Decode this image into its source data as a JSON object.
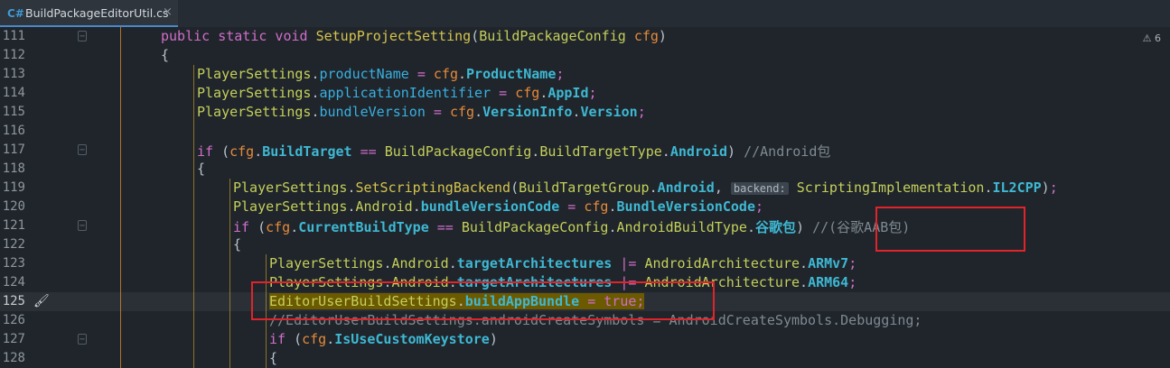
{
  "tab": {
    "lang": "C#",
    "filename": "BuildPackageEditorUtil.cs",
    "close": "×"
  },
  "warnings": {
    "icon": "warning-icon",
    "count": "6"
  },
  "lines": [
    {
      "num": "111",
      "text": "public static void SetupProjectSetting(BuildPackageConfig cfg)"
    },
    {
      "num": "112",
      "text": "{"
    },
    {
      "num": "113",
      "text": "PlayerSettings.productName = cfg.ProductName;"
    },
    {
      "num": "114",
      "text": "PlayerSettings.applicationIdentifier = cfg.AppId;"
    },
    {
      "num": "115",
      "text": "PlayerSettings.bundleVersion = cfg.VersionInfo.Version;"
    },
    {
      "num": "116",
      "text": ""
    },
    {
      "num": "117",
      "text": "if (cfg.BuildTarget == BuildPackageConfig.BuildTargetType.Android) //Android包"
    },
    {
      "num": "118",
      "text": "{"
    },
    {
      "num": "119",
      "text": "PlayerSettings.SetScriptingBackend(BuildTargetGroup.Android, backend: ScriptingImplementation.IL2CPP);"
    },
    {
      "num": "120",
      "text": "PlayerSettings.Android.bundleVersionCode = cfg.BundleVersionCode;"
    },
    {
      "num": "121",
      "text": "if (cfg.CurrentBuildType == BuildPackageConfig.AndroidBuildType.谷歌包) //(谷歌AAB包)"
    },
    {
      "num": "122",
      "text": "{"
    },
    {
      "num": "123",
      "text": "PlayerSettings.Android.targetArchitectures |= AndroidArchitecture.ARMv7;"
    },
    {
      "num": "124",
      "text": "PlayerSettings.Android.targetArchitectures |= AndroidArchitecture.ARM64;"
    },
    {
      "num": "125",
      "text": "EditorUserBuildSettings.buildAppBundle = true;"
    },
    {
      "num": "126",
      "text": "//EditorUserBuildSettings.androidCreateSymbols = AndroidCreateSymbols.Debugging;"
    },
    {
      "num": "127",
      "text": "if (cfg.IsUseCustomKeystore)"
    },
    {
      "num": "128",
      "text": "{"
    }
  ],
  "inlay_hint": "backend:",
  "comment_android": "//Android包",
  "comment_aab": "//(谷歌AAB包)",
  "current_line": "125"
}
